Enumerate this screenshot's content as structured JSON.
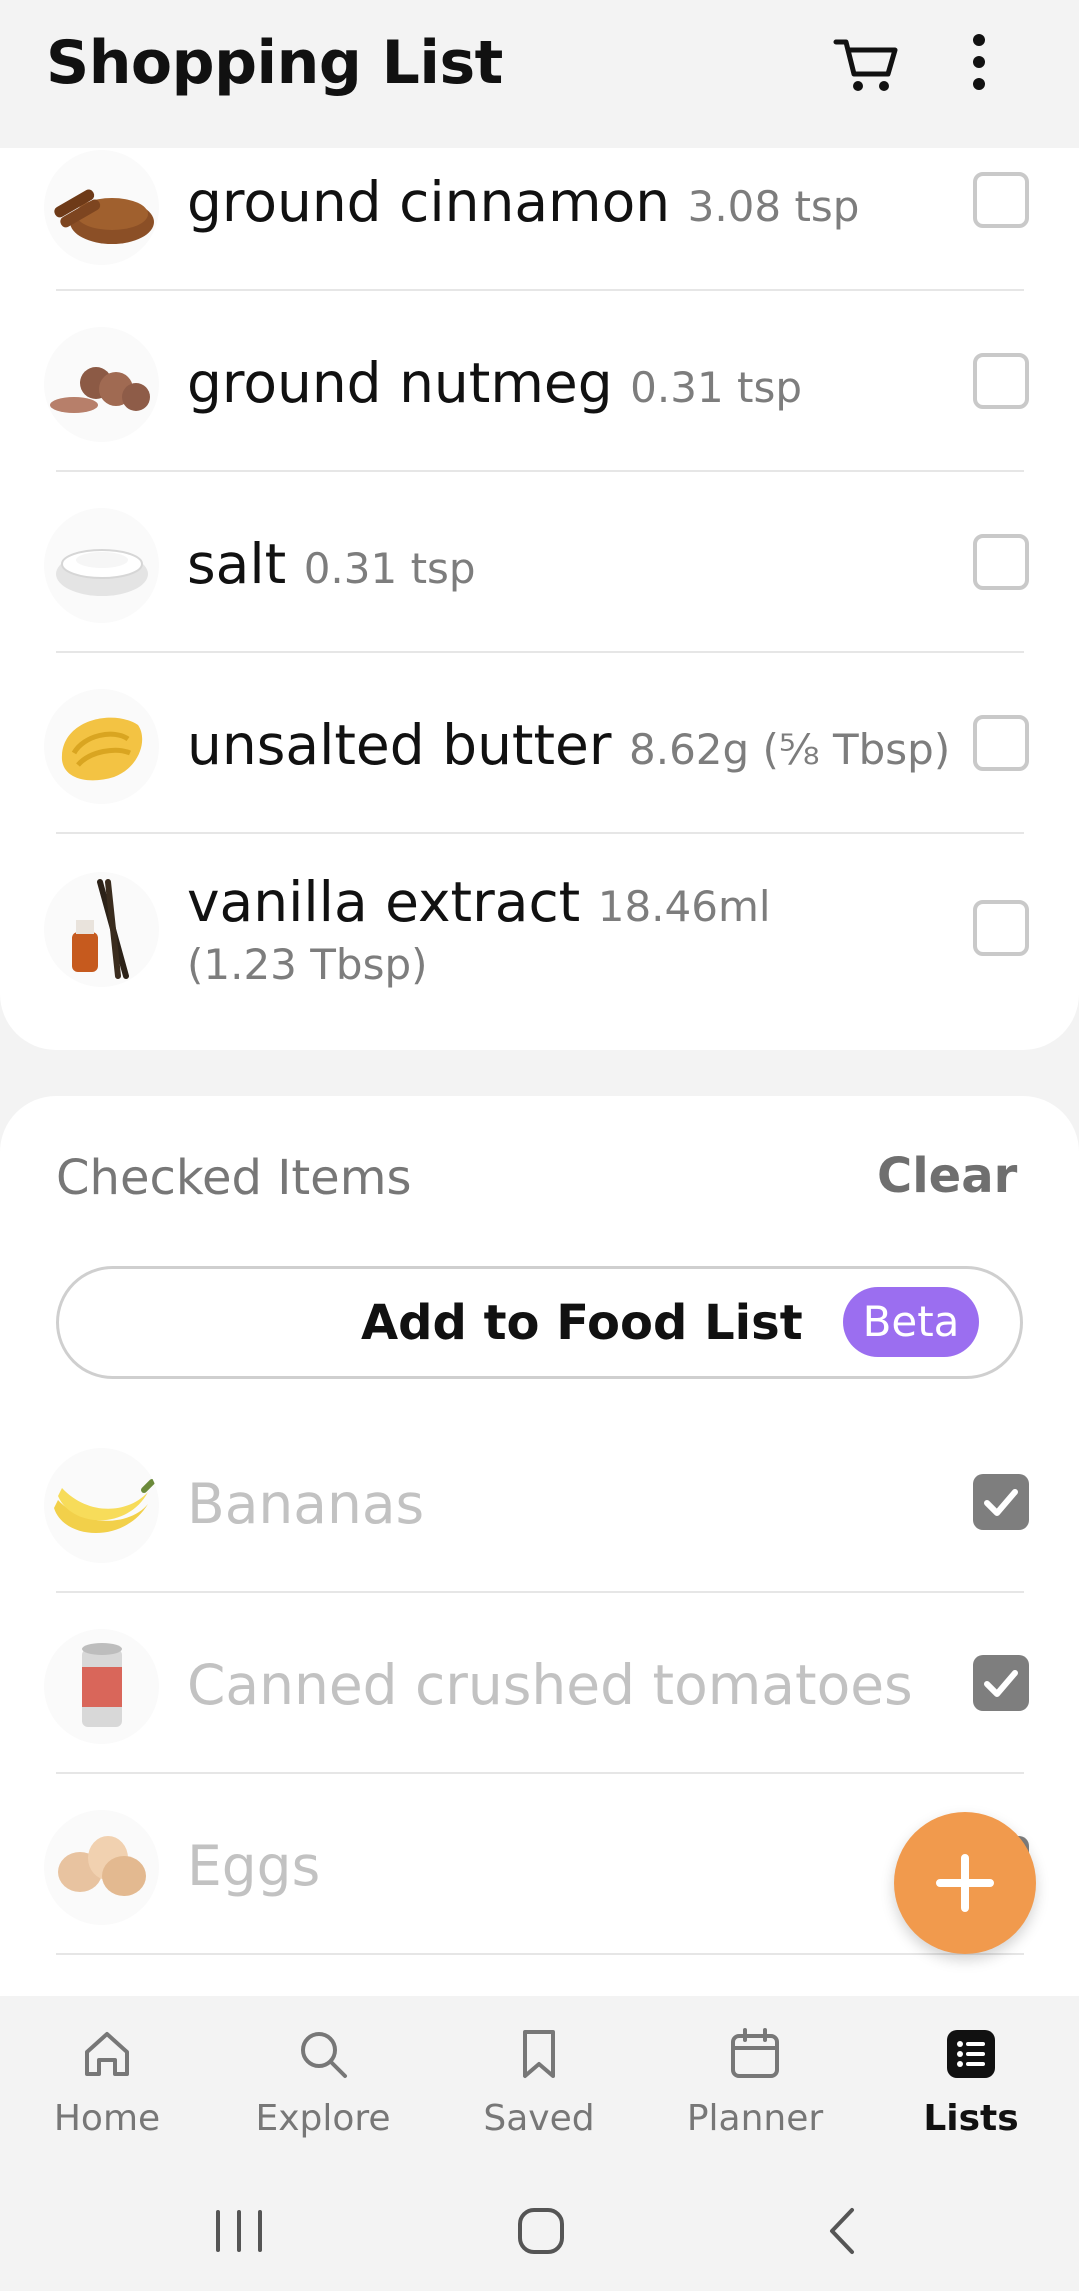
{
  "header": {
    "title": "Shopping List",
    "cart_icon": "cart-icon",
    "more_icon": "more-vertical-icon"
  },
  "unchecked_items": [
    {
      "name": "ground cinnamon",
      "qty": "3.08 tsp",
      "qty_line2": "",
      "checked": false,
      "icon": "cinnamon-image"
    },
    {
      "name": "ground nutmeg",
      "qty": "0.31 tsp",
      "qty_line2": "",
      "checked": false,
      "icon": "nutmeg-image"
    },
    {
      "name": "salt",
      "qty": "0.31 tsp",
      "qty_line2": "",
      "checked": false,
      "icon": "salt-image"
    },
    {
      "name": "unsalted butter",
      "qty": "8.62g (⅝ Tbsp)",
      "qty_line2": "",
      "checked": false,
      "icon": "butter-image"
    },
    {
      "name": "vanilla extract",
      "qty": "18.46ml",
      "qty_line2": "(1.23 Tbsp)",
      "checked": false,
      "icon": "vanilla-image"
    }
  ],
  "checked_section": {
    "title": "Checked Items",
    "clear_label": "Clear",
    "add_to_food_list_label": "Add to Food List",
    "beta_badge": "Beta",
    "items": [
      {
        "name": "Bananas",
        "checked": true,
        "icon": "banana-image"
      },
      {
        "name": "Canned crushed tomatoes",
        "checked": true,
        "icon": "can-image"
      },
      {
        "name": "Eggs",
        "checked": true,
        "icon": "eggs-image"
      }
    ]
  },
  "fab": {
    "icon": "plus-icon",
    "color": "#f19a4d"
  },
  "bottom_nav": {
    "items": [
      {
        "label": "Home",
        "icon": "home-icon",
        "active": false
      },
      {
        "label": "Explore",
        "icon": "search-icon",
        "active": false
      },
      {
        "label": "Saved",
        "icon": "bookmark-icon",
        "active": false
      },
      {
        "label": "Planner",
        "icon": "calendar-icon",
        "active": false
      },
      {
        "label": "Lists",
        "icon": "list-icon",
        "active": true
      }
    ]
  },
  "system_nav": {
    "recents_icon": "recents-icon",
    "home_icon": "home-circle-icon",
    "back_icon": "back-icon"
  },
  "colors": {
    "accent_purple": "#9b6ef0",
    "fab_orange": "#f19a4d",
    "checkbox_checked": "#7e7e7e"
  }
}
